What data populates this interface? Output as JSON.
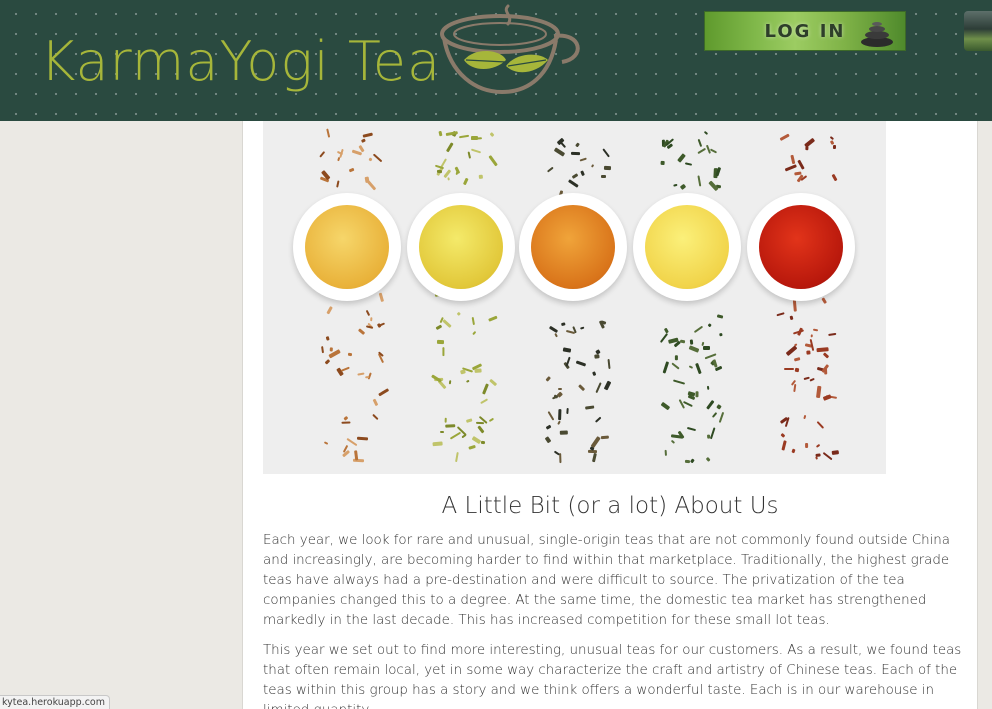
{
  "header": {
    "brand": "KarmaYogi Tea",
    "login_label": "LOG IN"
  },
  "main": {
    "hero_alt": "Five teas with brewed cups",
    "heading": "A Little Bit (or a lot) About Us",
    "paragraphs": [
      "Each year, we look for rare and unusual, single-origin teas that are not commonly found outside China and increasingly, are becoming harder to find within that marketplace. Traditionally, the highest grade teas have always had a pre-destination and were difficult to source. The privatization of the tea companies changed this to a degree. At the same time, the domestic tea market has strengthened markedly in the last decade. This has increased competition for these small lot teas.",
      "This year we set out to find more interesting, unusual teas for our customers. As a result, we found teas that often remain local, yet in some way characterize the craft and artistry of Chinese teas. Each of the teas within this group has a story and we think offers a wonderful taste. Each is in our warehouse in limited quantity."
    ]
  },
  "statusbar": {
    "url": "kytea.herokuapp.com"
  },
  "colors": {
    "header_bg": "#2a4a40",
    "brand": "#a6b63a",
    "page_bg": "#ebe9e4"
  },
  "icons": {
    "logo": "teacup-icon",
    "login": "stones-icon"
  }
}
